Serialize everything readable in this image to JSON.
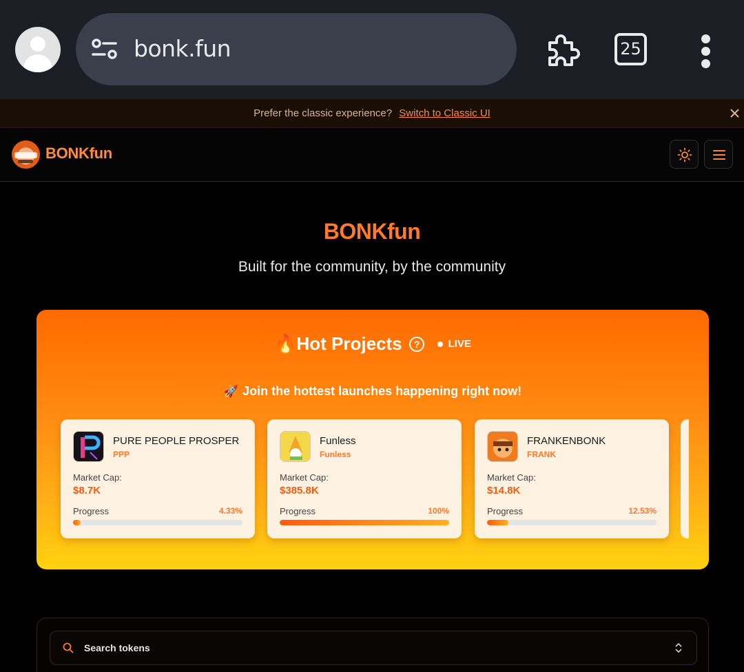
{
  "browser": {
    "url": "bonk.fun",
    "tab_count": "25",
    "icons": [
      "account-icon",
      "site-settings-icon",
      "extensions-icon",
      "tab-switcher-icon",
      "more-menu-icon"
    ]
  },
  "banner": {
    "text": "Prefer the classic experience?",
    "link": "Switch to Classic UI"
  },
  "header": {
    "brand": "BONKfun"
  },
  "hero": {
    "title": "BONKfun",
    "subtitle": "Built for the community, by the community"
  },
  "hot_projects": {
    "fire": "🔥",
    "title": "Hot Projects",
    "help": "?",
    "live": "LIVE",
    "rocket": "🚀",
    "subtitle": "Join the hottest launches happening right now!",
    "labels": {
      "market_cap": "Market Cap:",
      "progress": "Progress"
    },
    "cards": [
      {
        "name": "PURE PEOPLE PROSPER",
        "symbol": "PPP",
        "market_cap": "$8.7K",
        "progress": "4.33%",
        "progress_value": 4.33
      },
      {
        "name": "Funless",
        "symbol": "Funless",
        "market_cap": "$385.8K",
        "progress": "100%",
        "progress_value": 100
      },
      {
        "name": "FRANKENBONK",
        "symbol": "FRANK",
        "market_cap": "$14.8K",
        "progress": "12.53%",
        "progress_value": 12.53
      }
    ]
  },
  "search": {
    "placeholder": "Search tokens"
  },
  "colors": {
    "accent": "#ff7a2a",
    "chrome_bg": "#1b1e24",
    "omnibox_bg": "#3a3f4b"
  }
}
